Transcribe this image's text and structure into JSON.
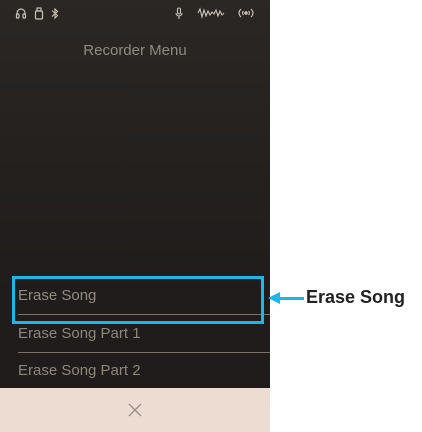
{
  "status_bar": {
    "icons": [
      "headphones-icon",
      "usb-icon",
      "bluetooth-icon",
      "mic-icon",
      "waveform-icon",
      "wireless-icon"
    ]
  },
  "screen": {
    "title": "Recorder Menu"
  },
  "menu": {
    "items": [
      {
        "label": "Erase Song",
        "selected": true
      },
      {
        "label": "Erase Song Part 1",
        "selected": false
      },
      {
        "label": "Erase Song Part 2",
        "selected": false
      }
    ]
  },
  "bottom_bar": {
    "close_icon": "close-icon"
  },
  "annotation": {
    "label": "Erase Song",
    "accent_color": "#1bb7e8"
  }
}
